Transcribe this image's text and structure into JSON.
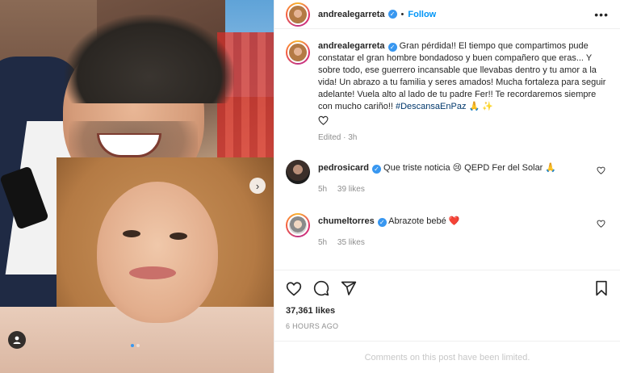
{
  "post": {
    "username": "andrealegarreta",
    "follow_label": "Follow",
    "more_label": "•••",
    "separator": "•",
    "caption_parts": {
      "text": "Gran pérdida!! El tiempo que compartimos pude constatar el gran hombre bondadoso y buen compañero que eras... Y sobre todo, ese guerrero incansable que llevabas dentro y tu amor a la vida! Un abrazo a tu familia y seres amados! Mucha fortaleza para seguir adelante! Vuela alto al lado de tu padre Fer!! Te recordaremos siempre con mucho cariño!! ",
      "hashtag": "#DescansaEnPaz",
      "emoji": " 🙏 ✨"
    },
    "caption_meta": "Edited · 3h"
  },
  "comments": [
    {
      "username": "pedrosicard",
      "text": "Que triste noticia 😢 QEPD Fer del Solar 🙏",
      "time": "5h",
      "likes": "39 likes"
    },
    {
      "username": "chumeltorres",
      "text": "Abrazote bebé ❤️",
      "time": "5h",
      "likes": "35 likes"
    }
  ],
  "actions": {
    "likes_count": "37,361 likes",
    "time_ago": "6 HOURS AGO"
  },
  "footer": {
    "limited_text": "Comments on this post have been limited."
  },
  "carousel": {
    "next_arrow": "›"
  }
}
